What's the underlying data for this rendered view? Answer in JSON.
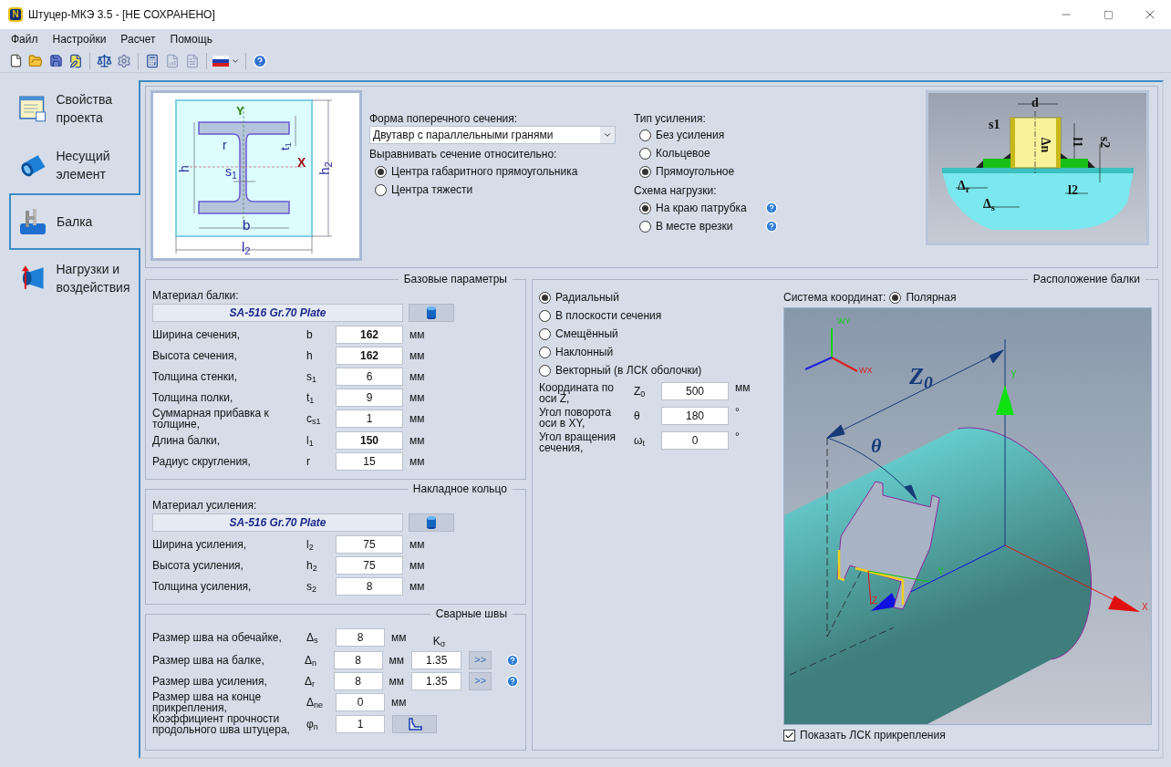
{
  "window": {
    "logo_letter": "N",
    "title": "Штуцер-МКЭ 3.5 - [НЕ СОХРАНЕНО]"
  },
  "menu": [
    "Файл",
    "Настройки",
    "Расчет",
    "Помощь"
  ],
  "nav": [
    {
      "label": "Свойства проекта",
      "selected": false
    },
    {
      "label": "Несущий элемент",
      "selected": false
    },
    {
      "label": "Балка",
      "selected": true
    },
    {
      "label": "Нагрузки и воздействия",
      "selected": false
    }
  ],
  "section": {
    "diagram_labels": [
      "Y",
      "X",
      "r",
      "t$_{1}$",
      "h",
      "s$_{1}$",
      "b",
      "l$_{2}$",
      "h$_{2}$"
    ],
    "shape_label": "Форма поперечного сечения:",
    "shape_value": "Двутавр с параллельными гранями",
    "align_label": "Выравнивать сечение относительно:",
    "align_options": [
      {
        "label": "Центра габаритного прямоугольника",
        "selected": true
      },
      {
        "label": "Центра тяжести",
        "selected": false
      }
    ]
  },
  "reinforcement": {
    "label": "Тип усиления:",
    "options": [
      {
        "label": "Без усиления",
        "selected": false
      },
      {
        "label": "Кольцевое",
        "selected": false
      },
      {
        "label": "Прямоугольное",
        "selected": true
      }
    ],
    "load_label": "Схема нагрузки:",
    "load_options": [
      {
        "label": "На краю патрубка",
        "selected": true
      },
      {
        "label": "В месте врезки",
        "selected": false
      }
    ],
    "diagram_labels": [
      "d",
      "s1",
      "Δn",
      "l1",
      "s2",
      "Δ$_{r}$",
      "Δ$_{s}$",
      "l2"
    ]
  },
  "base_params": {
    "title": "Базовые параметры",
    "material_label": "Материал балки:",
    "material": "SA-516 Gr.70 Plate",
    "rows": [
      {
        "label": "Ширина сечения,",
        "symbol": "b",
        "value": "162",
        "unit": "мм",
        "bold": true
      },
      {
        "label": "Высота сечения,",
        "symbol": "h",
        "value": "162",
        "unit": "мм",
        "bold": true
      },
      {
        "label": "Толщина стенки,",
        "symbol": "s$_{1}$",
        "value": "6",
        "unit": "мм",
        "bold": false
      },
      {
        "label": "Толщина полки,",
        "symbol": "t$_{1}$",
        "value": "9",
        "unit": "мм",
        "bold": false
      },
      {
        "label": "Суммарная прибавка к толщине,",
        "symbol": "c$_{s1}$",
        "value": "1",
        "unit": "мм",
        "bold": false
      },
      {
        "label": "Длина балки,",
        "symbol": "l$_{1}$",
        "value": "150",
        "unit": "мм",
        "bold": true
      },
      {
        "label": "Радиус скругления,",
        "symbol": "r",
        "value": "15",
        "unit": "мм",
        "bold": false
      }
    ]
  },
  "ring": {
    "title": "Накладное кольцо",
    "material_label": "Материал усиления:",
    "material": "SA-516 Gr.70 Plate",
    "rows": [
      {
        "label": "Ширина усиления,",
        "symbol": "l$_{2}$",
        "value": "75",
        "unit": "мм",
        "bold": false
      },
      {
        "label": "Высота усиления,",
        "symbol": "h$_{2}$",
        "value": "75",
        "unit": "мм",
        "bold": false
      },
      {
        "label": "Толщина усиления,",
        "symbol": "s$_{2}$",
        "value": "8",
        "unit": "мм",
        "bold": false
      }
    ]
  },
  "welds": {
    "title": "Сварные швы",
    "k_header": "K$_{σ}$",
    "rows": [
      {
        "kind": "basic",
        "label": "Размер шва на обечайке,",
        "symbol": "Δ$_{s}$",
        "value": "8",
        "unit": "мм"
      },
      {
        "kind": "factor",
        "label": "Размер шва на балке,",
        "symbol": "Δ$_{n}$",
        "value": "8",
        "unit": "мм",
        "k": "1.35",
        "button": ">>"
      },
      {
        "kind": "factor",
        "label": "Размер шва усиления,",
        "symbol": "Δ$_{r}$",
        "value": "8",
        "unit": "мм",
        "k": "1.35",
        "button": ">>"
      },
      {
        "kind": "basic",
        "label": "Размер шва на конце прикрепления,",
        "symbol": "Δ$_{ne}$",
        "value": "0",
        "unit": "мм"
      },
      {
        "kind": "icon",
        "label": "Коэффициент прочности продольного шва штуцера,",
        "symbol": "φ$_{n}$",
        "value": "1"
      }
    ]
  },
  "placement": {
    "title": "Расположение балки",
    "options": [
      {
        "label": "Радиальный",
        "selected": true
      },
      {
        "label": "В плоскости сечения",
        "selected": false
      },
      {
        "label": "Смещённый",
        "selected": false
      },
      {
        "label": "Наклонный",
        "selected": false
      },
      {
        "label": "Векторный (в ЛСК оболочки)",
        "selected": false
      }
    ],
    "fields": [
      {
        "label": "Координата по оси Z,",
        "symbol": "Z$_{0}$",
        "value": "500",
        "unit": "мм"
      },
      {
        "label": "Угол поворота оси в XY,",
        "symbol": "θ",
        "value": "180",
        "unit": "°"
      },
      {
        "label": "Угол вращения сечения,",
        "symbol": "ω$_{t}$",
        "value": "0",
        "unit": "°"
      }
    ],
    "coord_label": "Система координат:",
    "coord_option": {
      "label": "Полярная",
      "selected": true
    },
    "view_labels": [
      "Z$_{0}$",
      "θ",
      "WY",
      "WX",
      "Y",
      "X",
      "Y",
      "Z"
    ],
    "show_lcs": {
      "label": "Показать ЛСК прикрепления",
      "checked": true
    }
  }
}
